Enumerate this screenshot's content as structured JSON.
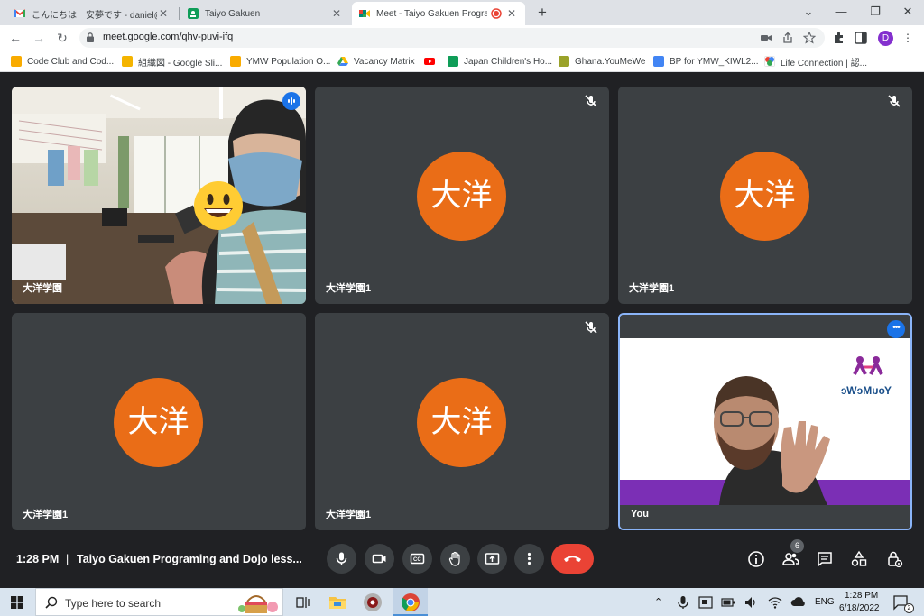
{
  "browser": {
    "tabs": [
      {
        "title": "こんにちは　安夢です - daniel@you",
        "icon": "gmail-icon",
        "active": false
      },
      {
        "title": "Taiyo Gakuen",
        "icon": "classroom-icon",
        "active": false
      },
      {
        "title": "Meet - Taiyo Gakuen Program",
        "icon": "meet-icon",
        "active": true
      }
    ],
    "url": "meet.google.com/qhv-puvi-ifq",
    "profile_initial": "D",
    "bookmarks": [
      {
        "label": "Code Club and Cod...",
        "icon": "folder-icon",
        "color": "#f9ab00"
      },
      {
        "label": "組織図 - Google Sli...",
        "icon": "slides-icon",
        "color": "#f4b400"
      },
      {
        "label": "YMW Population O...",
        "icon": "folder-icon",
        "color": "#f9ab00"
      },
      {
        "label": "Vacancy Matrix",
        "icon": "drive-icon",
        "color": "#34a853"
      },
      {
        "label": "",
        "icon": "youtube-icon",
        "color": "#ff0000"
      },
      {
        "label": "Japan Children's Ho...",
        "icon": "sheets-icon",
        "color": "#0f9d58"
      },
      {
        "label": "Ghana.YouMeWe",
        "icon": "image-icon",
        "color": "#9aa22a"
      },
      {
        "label": "BP for YMW_KIWL2...",
        "icon": "docs-icon",
        "color": "#4285f4"
      },
      {
        "label": "Life Connection | 認...",
        "icon": "site-icon",
        "color": "#7b61ff"
      }
    ]
  },
  "meet": {
    "tiles": [
      {
        "name": "大洋学園",
        "type": "video",
        "muted": false
      },
      {
        "name": "大洋学園1",
        "avatar": "大洋",
        "muted": true
      },
      {
        "name": "大洋学園1",
        "avatar": "大洋",
        "muted": true
      },
      {
        "name": "大洋学園1",
        "avatar": "大洋",
        "muted": false
      },
      {
        "name": "大洋学園1",
        "avatar": "大洋",
        "muted": true
      },
      {
        "name": "You",
        "type": "self-video",
        "muted": false
      }
    ],
    "self_logo_text": "YouMeWe",
    "controls": {
      "time": "1:28 PM",
      "separator": "|",
      "meeting_title": "Taiyo Gakuen Programing and Dojo less...",
      "participant_count": "6"
    },
    "colors": {
      "avatar_bg": "#ea6d17",
      "end_call": "#ea4335",
      "tile_bg": "#3c4043",
      "accent": "#1a73e8"
    }
  },
  "taskbar": {
    "search_placeholder": "Type here to search",
    "language": "ENG",
    "time": "1:28 PM",
    "date": "6/18/2022",
    "notification_count": "2"
  }
}
